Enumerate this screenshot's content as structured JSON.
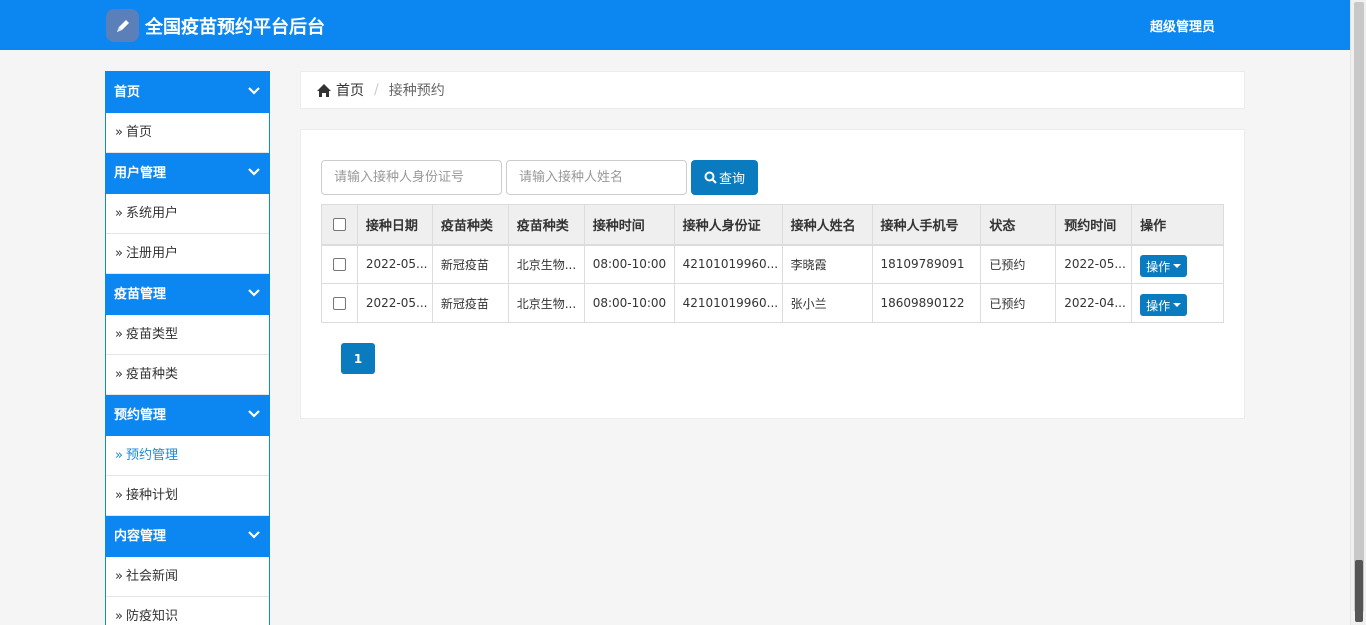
{
  "header": {
    "title": "全国疫苗预约平台后台",
    "user": "超级管理员",
    "logo_icon": "pen-icon",
    "bg_color": "#0c86f0"
  },
  "sidebar": {
    "groups": [
      {
        "title": "首页",
        "items": [
          {
            "label": "首页",
            "active": false
          }
        ]
      },
      {
        "title": "用户管理",
        "items": [
          {
            "label": "系统用户",
            "active": false
          },
          {
            "label": "注册用户",
            "active": false
          }
        ]
      },
      {
        "title": "疫苗管理",
        "items": [
          {
            "label": "疫苗类型",
            "active": false
          },
          {
            "label": "疫苗种类",
            "active": false
          }
        ]
      },
      {
        "title": "预约管理",
        "items": [
          {
            "label": "预约管理",
            "active": true
          },
          {
            "label": "接种计划",
            "active": false
          }
        ]
      },
      {
        "title": "内容管理",
        "items": [
          {
            "label": "社会新闻",
            "active": false
          },
          {
            "label": "防疫知识",
            "active": false
          }
        ]
      }
    ]
  },
  "breadcrumb": {
    "home": "首页",
    "separator": "/",
    "current": "接种预约"
  },
  "search": {
    "id_placeholder": "请输入接种人身份证号",
    "name_placeholder": "请输入接种人姓名",
    "button": "查询"
  },
  "table": {
    "headers": [
      "接种日期",
      "疫苗种类",
      "疫苗种类",
      "接种时间",
      "接种人身份证",
      "接种人姓名",
      "接种人手机号",
      "状态",
      "预约时间",
      "操作"
    ],
    "rows": [
      [
        "2022-05...",
        "新冠疫苗",
        "北京生物...",
        "08:00-10:00",
        "42101019960...",
        "李晓霞",
        "18109789091",
        "已预约",
        "2022-05...",
        "操作"
      ],
      [
        "2022-05...",
        "新冠疫苗",
        "北京生物...",
        "08:00-10:00",
        "42101019960...",
        "张小兰",
        "18609890122",
        "已预约",
        "2022-04...",
        "操作"
      ]
    ]
  },
  "pagination": {
    "current": "1"
  }
}
